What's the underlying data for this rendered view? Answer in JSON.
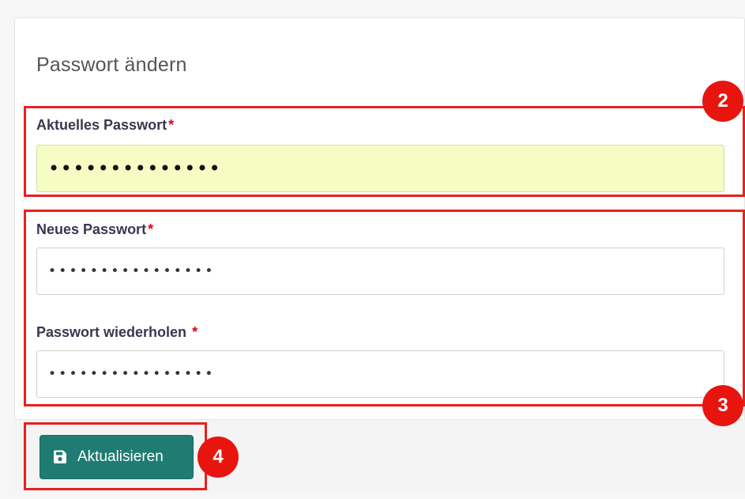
{
  "form": {
    "title": "Passwort ändern",
    "current_password": {
      "label": "Aktuelles Passwort",
      "required_mark": "*",
      "masked_value": "••••••••••••••"
    },
    "new_password": {
      "label": "Neues Passwort",
      "required_mark": "*",
      "masked_value": "••••••••••••••••"
    },
    "repeat_password": {
      "label": "Passwort wiederholen ",
      "required_mark": "*",
      "masked_value": "••••••••••••••••"
    },
    "submit": {
      "label": "Aktualisieren",
      "icon": "save-icon"
    }
  },
  "annotations": {
    "badge_2": "2",
    "badge_3": "3",
    "badge_4": "4"
  },
  "colors": {
    "accent_button": "#1f7c72",
    "annotation_red": "#e8201e",
    "required_red": "#e0001a",
    "autofill_bg": "#f5fdc4"
  }
}
